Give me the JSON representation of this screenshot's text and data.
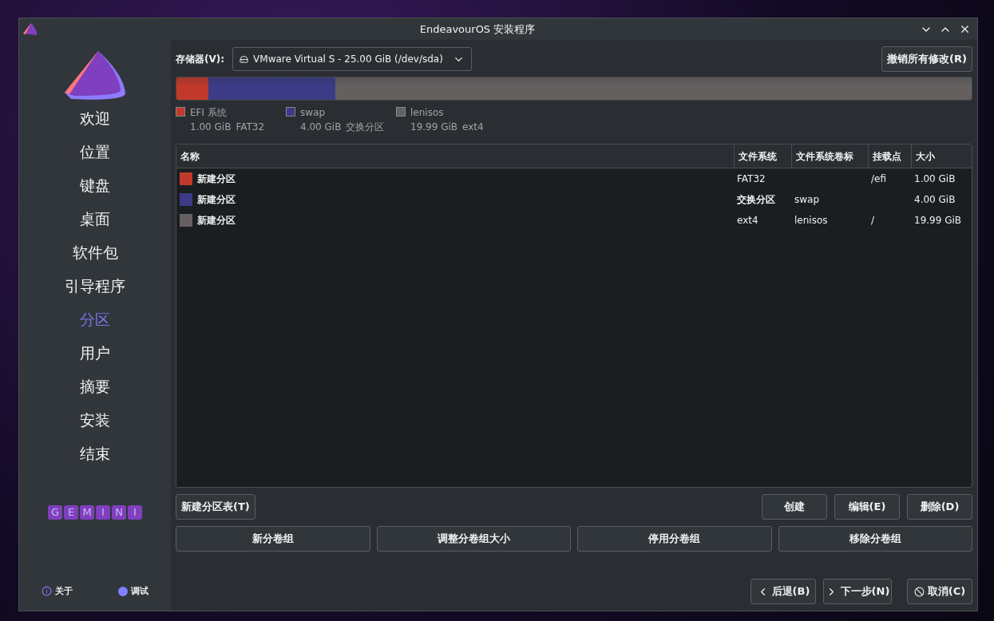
{
  "window": {
    "title": "EndeavourOS 安装程序"
  },
  "sidebar": {
    "items": [
      {
        "label": "欢迎",
        "selected": false
      },
      {
        "label": "位置",
        "selected": false
      },
      {
        "label": "键盘",
        "selected": false
      },
      {
        "label": "桌面",
        "selected": false
      },
      {
        "label": "软件包",
        "selected": false
      },
      {
        "label": "引导程序",
        "selected": false
      },
      {
        "label": "分区",
        "selected": true
      },
      {
        "label": "用户",
        "selected": false
      },
      {
        "label": "摘要",
        "selected": false
      },
      {
        "label": "安装",
        "selected": false
      },
      {
        "label": "结束",
        "selected": false
      }
    ],
    "brand": [
      "G",
      "E",
      "M",
      "I",
      "N",
      "I"
    ],
    "about": "关于",
    "debug": "调试"
  },
  "storage": {
    "label": "存储器(V):",
    "device": "VMware Virtual S - 25.00 GiB (/dev/sda)",
    "revert_button": "撤销所有修改(R)"
  },
  "partitions": [
    {
      "name": "EFI 系统",
      "size": "1.00 GiB",
      "fs": "FAT32",
      "level": 0.04,
      "color": "#c0392b"
    },
    {
      "name": "swap",
      "size": "4.00 GiB",
      "fs": "交换分区",
      "level": 0.16,
      "color": "#3b3b86"
    },
    {
      "name": "lenisos",
      "size": "19.99 GiB",
      "fs": "ext4",
      "level": 0.8,
      "color": "#646060"
    }
  ],
  "table": {
    "columns": [
      "名称",
      "文件系统",
      "文件系统卷标",
      "挂载点",
      "大小"
    ],
    "rows": [
      {
        "name": "新建分区",
        "color": "#c0392b",
        "filesystem": "FAT32",
        "filesystem_bold": false,
        "mount": "/efi",
        "size": "1.00 GiB"
      },
      {
        "name": "新建分区",
        "color": "#3b3b86",
        "filesystem": "交换分区",
        "filesystem_bold": true,
        "label": "swap",
        "size": "4.00 GiB"
      },
      {
        "name": "新建分区",
        "color": "#646060",
        "filesystem": "ext4",
        "filesystem_bold": false,
        "label": "lenisos",
        "mount": "/",
        "size": "19.99 GiB"
      }
    ]
  },
  "actions": {
    "new_table": "新建分区表(T)",
    "right": [
      "创建",
      "编辑(E)",
      "删除(D)"
    ],
    "volume_groups": [
      "新分卷组",
      "调整分卷组大小",
      "停用分卷组",
      "移除分卷组"
    ]
  },
  "nav": {
    "back": "后退(B)",
    "next": "下一步(N)",
    "cancel": "取消(C)"
  }
}
